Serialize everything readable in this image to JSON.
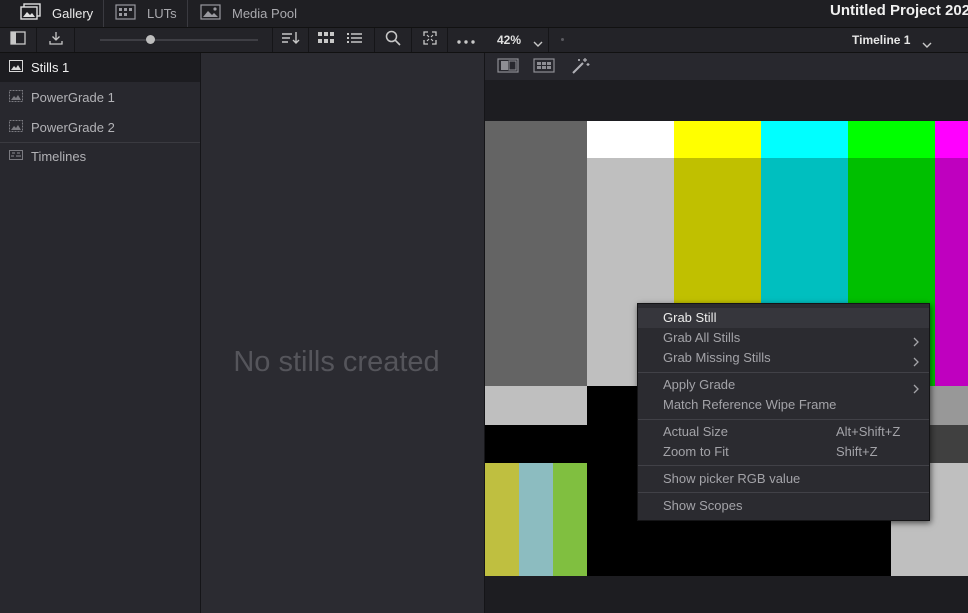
{
  "tabs": [
    {
      "label": "Gallery",
      "icon": "gallery-icon",
      "active": true
    },
    {
      "label": "LUTs",
      "icon": "luts-icon",
      "active": false
    },
    {
      "label": "Media Pool",
      "icon": "media-pool-icon",
      "active": false
    }
  ],
  "project_title": "Untitled Project 202",
  "viewer": {
    "zoom": "42%",
    "timeline": "Timeline 1"
  },
  "albums": [
    {
      "label": "Stills 1",
      "icon": "stills-album-icon",
      "selected": true
    },
    {
      "label": "PowerGrade 1",
      "icon": "powergrade-icon",
      "selected": false
    },
    {
      "label": "PowerGrade 2",
      "icon": "powergrade-icon",
      "selected": false
    },
    {
      "label": "Timelines",
      "icon": "timelines-icon",
      "selected": false
    }
  ],
  "stills_empty_text": "No stills created",
  "context_menu": [
    {
      "label": "Grab Still",
      "shortcut": "",
      "submenu": false,
      "highlighted": true
    },
    {
      "label": "Grab All Stills",
      "shortcut": "",
      "submenu": true
    },
    {
      "label": "Grab Missing Stills",
      "shortcut": "",
      "submenu": true
    },
    {
      "label": "Apply Grade",
      "shortcut": "",
      "submenu": true
    },
    {
      "label": "Match Reference Wipe Frame",
      "shortcut": "",
      "submenu": false
    },
    {
      "label": "Actual Size",
      "shortcut": "Alt+Shift+Z",
      "submenu": false
    },
    {
      "label": "Zoom to Fit",
      "shortcut": "Shift+Z",
      "submenu": false
    },
    {
      "label": "Show picker RGB value",
      "shortcut": "",
      "submenu": false
    },
    {
      "label": "Show Scopes",
      "shortcut": "",
      "submenu": false
    }
  ],
  "colors": {
    "background": "#28282e",
    "menu_bg": "#2b2b30",
    "bar_gray": "#646464",
    "bar_white": "#ffffff",
    "bar_yellow": "#ffff00",
    "bar_cyan": "#00ffff",
    "bar_green": "#00ff00",
    "bar_magenta": "#ff00ff"
  }
}
